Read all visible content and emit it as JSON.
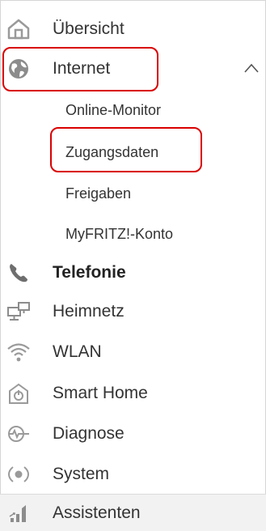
{
  "nav": {
    "items": [
      {
        "label": "Übersicht",
        "icon": "home-icon"
      },
      {
        "label": "Internet",
        "icon": "globe-icon",
        "expanded": true
      },
      {
        "label": "Telefonie",
        "icon": "phone-icon",
        "active": true
      },
      {
        "label": "Heimnetz",
        "icon": "network-icon"
      },
      {
        "label": "WLAN",
        "icon": "wifi-icon"
      },
      {
        "label": "Smart Home",
        "icon": "smart-home-icon"
      },
      {
        "label": "Diagnose",
        "icon": "diagnose-icon"
      },
      {
        "label": "System",
        "icon": "system-icon"
      },
      {
        "label": "Assistenten",
        "icon": "assistant-icon"
      }
    ],
    "internet_sub": [
      {
        "label": "Online-Monitor"
      },
      {
        "label": "Zugangsdaten"
      },
      {
        "label": "Freigaben"
      },
      {
        "label": "MyFRITZ!-Konto"
      }
    ]
  },
  "colors": {
    "icon": "#9a9a9a",
    "highlight": "#d90000",
    "phone_icon": "#6e6e6e"
  }
}
